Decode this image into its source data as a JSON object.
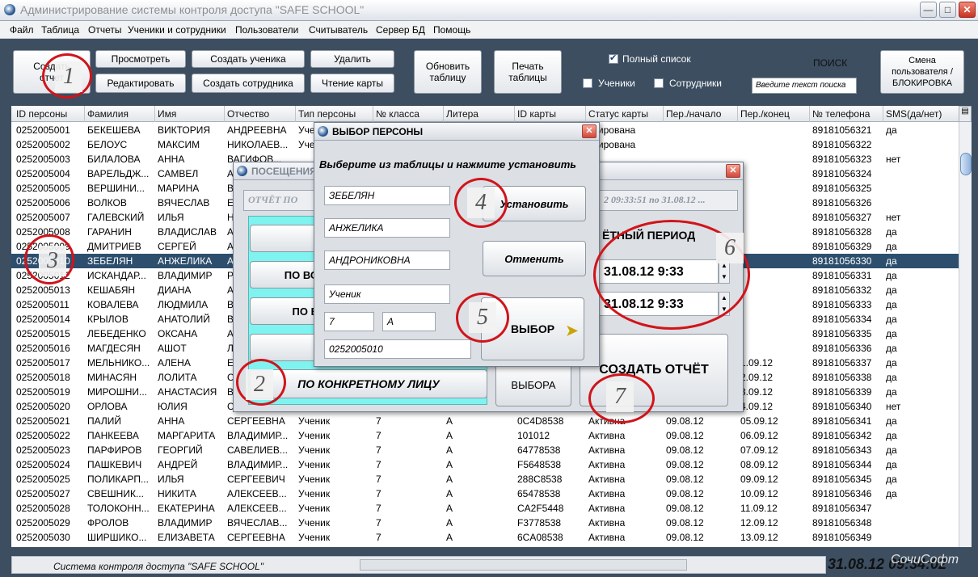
{
  "window": {
    "title": "Администрирование системы контроля доступа \"SAFE SCHOOL\""
  },
  "menu": [
    "Файл",
    "Таблица",
    "Отчеты",
    "Ученики и сотрудники",
    "Пользователи",
    "Считыватель",
    "Сервер БД",
    "Помощь"
  ],
  "toolbar": {
    "create_report": "Создать отчет",
    "view": "Просмотреть",
    "edit": "Редактировать",
    "create_student": "Создать ученика",
    "create_employee": "Создать сотрудника",
    "delete": "Удалить",
    "read_card": "Чтение карты",
    "refresh_table": "Обновить таблицу",
    "print_table": "Печать таблицы",
    "full_list": "Полный список",
    "students": "Ученики",
    "employees": "Сотрудники",
    "search_label": "ПОИСК",
    "search_placeholder": "Введите текст поиска",
    "change_user": "Смена пользователя /БЛОКИРОВКА"
  },
  "table": {
    "columns": [
      "ID персоны",
      "Фамилия",
      "Имя",
      "Отчество",
      "Тип персоны",
      "№ класса",
      "Литера",
      "ID карты",
      "Статус карты",
      "Пер./начало",
      "Пер./конец",
      "№ телефона",
      "SMS(да/нет)"
    ],
    "rows": [
      [
        "0252005001",
        "БЕКЕШЕВА",
        "ВИКТОРИЯ",
        "АНДРЕЕВНА",
        "Учен",
        "",
        "",
        "",
        "окирована",
        "",
        "",
        "89181056321",
        "да"
      ],
      [
        "0252005002",
        "БЕЛОУС",
        "МАКСИМ",
        "НИКОЛАЕВ...",
        "Учен",
        "",
        "",
        "",
        "окирована",
        "",
        "",
        "89181056322",
        ""
      ],
      [
        "0252005003",
        "БИЛАЛОВА",
        "АННА",
        "ВАГИФОВ...",
        "",
        "",
        "",
        "",
        "",
        "",
        "",
        "89181056323",
        "нет"
      ],
      [
        "0252005004",
        "ВАРЕЛЬДЖ...",
        "САМВЕЛ",
        "А",
        "",
        "",
        "",
        "",
        "",
        "",
        "",
        "89181056324",
        ""
      ],
      [
        "0252005005",
        "ВЕРШИНИ...",
        "МАРИНА",
        "В",
        "",
        "",
        "",
        "",
        "",
        "",
        "",
        "89181056325",
        ""
      ],
      [
        "0252005006",
        "ВОЛКОВ",
        "ВЯЧЕСЛАВ",
        "Е",
        "",
        "",
        "",
        "",
        "",
        "",
        "",
        "89181056326",
        ""
      ],
      [
        "0252005007",
        "ГАЛЕВСКИЙ",
        "ИЛЬЯ",
        "Н",
        "",
        "",
        "",
        "",
        "",
        "",
        "",
        "89181056327",
        "нет"
      ],
      [
        "0252005008",
        "ГАРАНИН",
        "ВЛАДИСЛАВ",
        "А",
        "",
        "",
        "",
        "",
        "",
        "",
        "",
        "89181056328",
        "да"
      ],
      [
        "0252005009",
        "ДМИТРИЕВ",
        "СЕРГЕЙ",
        "А",
        "",
        "",
        "",
        "",
        "",
        "",
        "",
        "89181056329",
        "да"
      ],
      [
        "0252005010",
        "ЗЕБЕЛЯН",
        "АНЖЕЛИКА",
        "А",
        "",
        "",
        "",
        "",
        "",
        "",
        "",
        "89181056330",
        "да"
      ],
      [
        "0252005012",
        "ИСКАНДАР...",
        "ВЛАДИМИР",
        "Р",
        "",
        "",
        "",
        "",
        "",
        "",
        "",
        "89181056331",
        "да"
      ],
      [
        "0252005013",
        "КЕШАБЯН",
        "ДИАНА",
        "А",
        "",
        "",
        "",
        "",
        "",
        "",
        "",
        "89181056332",
        "да"
      ],
      [
        "0252005011",
        "КОВАЛЕВА",
        "ЛЮДМИЛА",
        "В",
        "",
        "",
        "",
        "",
        "",
        "",
        "",
        "89181056333",
        "да"
      ],
      [
        "0252005014",
        "КРЫЛОВ",
        "АНАТОЛИЙ",
        "В",
        "",
        "",
        "",
        "",
        "",
        "",
        "",
        "89181056334",
        "да"
      ],
      [
        "0252005015",
        "ЛЕБЕДЕНКО",
        "ОКСАНА",
        "А",
        "",
        "",
        "",
        "",
        "",
        "",
        "",
        "89181056335",
        "да"
      ],
      [
        "0252005016",
        "МАГДЕСЯН",
        "АШОТ",
        "Л",
        "",
        "",
        "",
        "",
        "",
        "",
        "",
        "89181056336",
        "да"
      ],
      [
        "0252005017",
        "МЕЛЬНИКО...",
        "АЛЕНА",
        "Е",
        "",
        "",
        "",
        "",
        "",
        "",
        "1.09.12",
        "89181056337",
        "да"
      ],
      [
        "0252005018",
        "МИНАСЯН",
        "ЛОЛИТА",
        "С",
        "",
        "",
        "",
        "",
        "",
        "",
        "2.09.12",
        "89181056338",
        "да"
      ],
      [
        "0252005019",
        "МИРОШНИ...",
        "АНАСТАСИЯ",
        "В",
        "",
        "",
        "",
        "",
        "",
        "",
        "3.09.12",
        "89181056339",
        "да"
      ],
      [
        "0252005020",
        "ОРЛОВА",
        "ЮЛИЯ",
        "С",
        "",
        "",
        "",
        "",
        "",
        "",
        "4.09.12",
        "89181056340",
        "нет"
      ],
      [
        "0252005021",
        "ПАЛИЙ",
        "АННА",
        "СЕРГЕЕВНА",
        "Ученик",
        "7",
        "А",
        "0C4D8538",
        "Активна",
        "09.08.12",
        "05.09.12",
        "89181056341",
        "да"
      ],
      [
        "0252005022",
        "ПАНКЕЕВА",
        "МАРГАРИТА",
        "ВЛАДИМИР...",
        "Ученик",
        "7",
        "А",
        "101012",
        "Активна",
        "09.08.12",
        "06.09.12",
        "89181056342",
        "да"
      ],
      [
        "0252005023",
        "ПАРФИРОВ",
        "ГЕОРГИЙ",
        "САВЕЛИЕВ...",
        "Ученик",
        "7",
        "А",
        "64778538",
        "Активна",
        "09.08.12",
        "07.09.12",
        "89181056343",
        "да"
      ],
      [
        "0252005024",
        "ПАШКЕВИЧ",
        "АНДРЕЙ",
        "ВЛАДИМИР...",
        "Ученик",
        "7",
        "А",
        "F5648538",
        "Активна",
        "09.08.12",
        "08.09.12",
        "89181056344",
        "да"
      ],
      [
        "0252005025",
        "ПОЛИКАРП...",
        "ИЛЬЯ",
        "СЕРГЕЕВИЧ",
        "Ученик",
        "7",
        "А",
        "288C8538",
        "Активна",
        "09.08.12",
        "09.09.12",
        "89181056345",
        "да"
      ],
      [
        "0252005027",
        "СВЕШНИК...",
        "НИКИТА",
        "АЛЕКСЕЕВ...",
        "Ученик",
        "7",
        "А",
        "65478538",
        "Активна",
        "09.08.12",
        "10.09.12",
        "89181056346",
        "да"
      ],
      [
        "0252005028",
        "ТОЛОКОНН...",
        "ЕКАТЕРИНА",
        "АЛЕКСЕЕВ...",
        "Ученик",
        "7",
        "А",
        "CA2F5448",
        "Активна",
        "09.08.12",
        "11.09.12",
        "89181056347",
        ""
      ],
      [
        "0252005029",
        "ФРОЛОВ",
        "ВЛАДИМИР",
        "ВЯЧЕСЛАВ...",
        "Ученик",
        "7",
        "А",
        "F3778538",
        "Активна",
        "09.08.12",
        "12.09.12",
        "89181056348",
        ""
      ],
      [
        "0252005030",
        "ШИРШИКО...",
        "ЕЛИЗАВЕТА",
        "СЕРГЕЕВНА",
        "Ученик",
        "7",
        "А",
        "6CA08538",
        "Активна",
        "09.08.12",
        "13.09.12",
        "89181056349",
        ""
      ]
    ],
    "selected_row": 9
  },
  "visits_dialog": {
    "title": "ПОСЕЩЕНИЯ",
    "report_field": "ОТЧЁТ ПО",
    "period_range": "2 09:33:51 по 31.08.12 ...",
    "report_period_label": "ЁТНЫЙ ПЕРИОД",
    "date_from": "31.08.12 9:33",
    "date_to": "31.08.12 9:33",
    "option_2": "ПО ВО",
    "option_3": "ПО В",
    "option_specific": "ПО КОНКРЕТНОМУ ЛИЦУ",
    "selection": "ВЫБОРА",
    "create_report": "СОЗДАТЬ ОТЧЁТ"
  },
  "select_dialog": {
    "title": "ВЫБОР ПЕРСОНЫ",
    "instruction": "Выберите из таблицы и нажмите установить",
    "surname": "ЗЕБЕЛЯН",
    "name": "АНЖЕЛИКА",
    "patronymic": "АНДРОНИКОВНА",
    "type": "Ученик",
    "class": "7",
    "letter": "А",
    "id": "0252005010",
    "set": "Установить",
    "cancel": "Отменить",
    "choose": "ВЫБОР"
  },
  "annotations": [
    "1",
    "2",
    "3",
    "4",
    "5",
    "6",
    "7"
  ],
  "status": {
    "text": "Система контроля доступа \"SAFE SCHOOL\"",
    "clock": "31.08.12 09:34:02",
    "watermark": "СочиСофт"
  }
}
